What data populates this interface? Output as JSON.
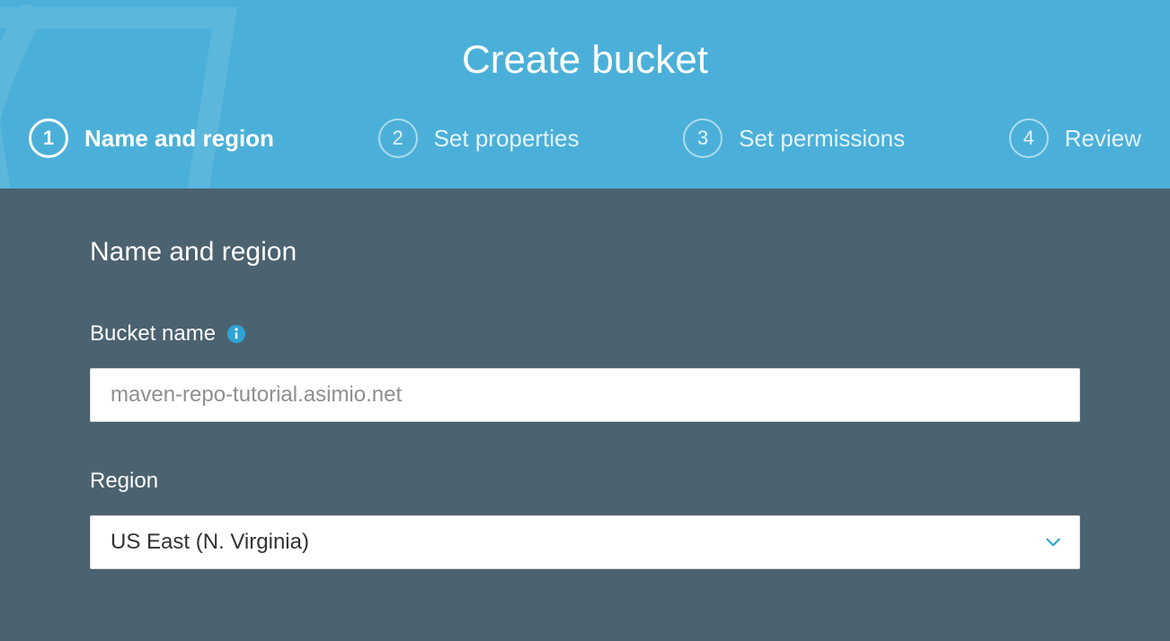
{
  "header": {
    "title": "Create bucket"
  },
  "steps": [
    {
      "num": "1",
      "label": "Name and region",
      "active": true
    },
    {
      "num": "2",
      "label": "Set properties",
      "active": false
    },
    {
      "num": "3",
      "label": "Set permissions",
      "active": false
    },
    {
      "num": "4",
      "label": "Review",
      "active": false
    }
  ],
  "form": {
    "section_heading": "Name and region",
    "bucket_name_label": "Bucket name",
    "bucket_name_value": "maven-repo-tutorial.asimio.net",
    "region_label": "Region",
    "region_value": "US East (N. Virginia)"
  },
  "icons": {
    "info": "info-icon",
    "chevron": "chevron-down-icon",
    "bucket_bg": "bucket-silhouette-icon"
  },
  "colors": {
    "header_bg": "#4bb0d9",
    "body_bg": "#4b6270",
    "info_icon": "#2ea3d6",
    "chevron": "#2ea3d6"
  }
}
